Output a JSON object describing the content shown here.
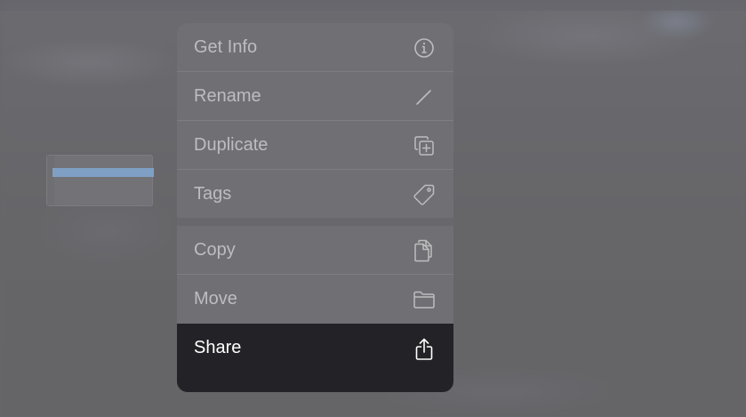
{
  "context_menu": {
    "items": [
      {
        "label": "Get Info",
        "icon": "info-icon"
      },
      {
        "label": "Rename",
        "icon": "pencil-icon"
      },
      {
        "label": "Duplicate",
        "icon": "duplicate-icon"
      },
      {
        "label": "Tags",
        "icon": "tag-icon"
      },
      {
        "label": "Copy",
        "icon": "copy-icon"
      },
      {
        "label": "Move",
        "icon": "folder-icon"
      },
      {
        "label": "Share",
        "icon": "share-icon",
        "highlighted": true
      }
    ]
  },
  "colors": {
    "menu_background": "#707074",
    "menu_text": "#bdbdc0",
    "highlight_background": "#232327",
    "highlight_text": "#ffffff",
    "file_stripe": "#7fa0c4"
  }
}
